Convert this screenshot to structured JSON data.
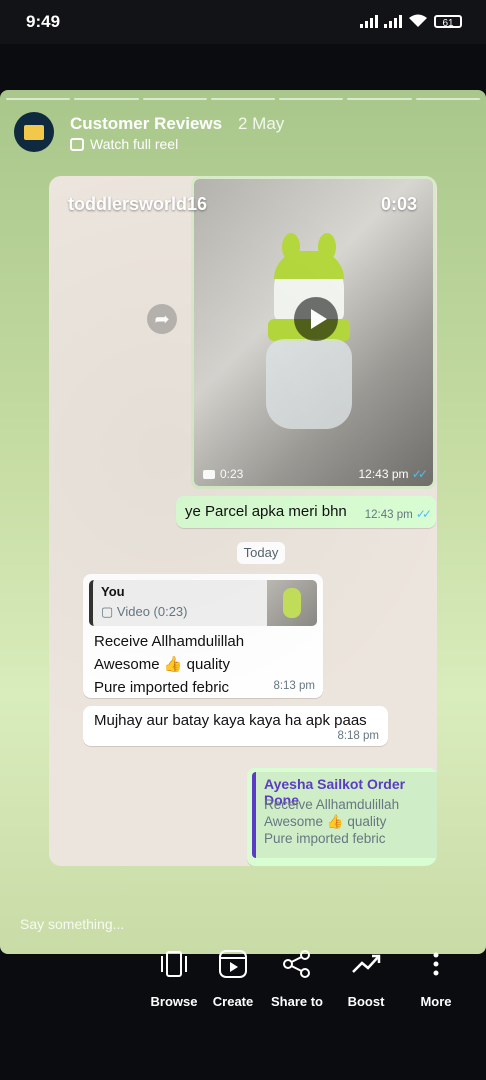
{
  "status_bar": {
    "time": "9:49",
    "battery": "61"
  },
  "story": {
    "account_name": "Customer Reviews",
    "date": "2 May",
    "watch_reel_label": "Watch full reel",
    "reply_placeholder": "Say something..."
  },
  "overlay": {
    "username": "toddlersworld16",
    "timer": "0:03"
  },
  "chat": {
    "video_duration": "0:23",
    "video_time": "12:43 pm",
    "msg1": {
      "text": "ye Parcel apka meri bhn",
      "time": "12:43 pm"
    },
    "date_chip": "Today",
    "msg2": {
      "quote_author": "You",
      "quote_text": "Video (0:23)",
      "line1": "Receive Allhamdulillah",
      "line2": "Awesome 👍 quality",
      "line3": "Pure imported febric",
      "time": "8:13 pm"
    },
    "msg3": {
      "text": "Mujhay aur batay kaya kaya ha apk paas",
      "time": "8:18 pm"
    },
    "msg4": {
      "quote_author": "Ayesha Sailkot Order Done",
      "line1": "Receive Allhamdulillah",
      "line2": "Awesome 👍 quality",
      "line3": "Pure imported febric"
    }
  },
  "actions": [
    {
      "label": "Browse",
      "icon": "browse-icon"
    },
    {
      "label": "Create",
      "icon": "create-icon"
    },
    {
      "label": "Share to",
      "icon": "share-icon"
    },
    {
      "label": "Boost",
      "icon": "boost-icon"
    },
    {
      "label": "More",
      "icon": "more-icon"
    }
  ],
  "colors": {
    "outgoing_bubble": "#d9fdd3",
    "read_ticks": "#53bdeb",
    "quote_accent": "#5b3cc4"
  }
}
